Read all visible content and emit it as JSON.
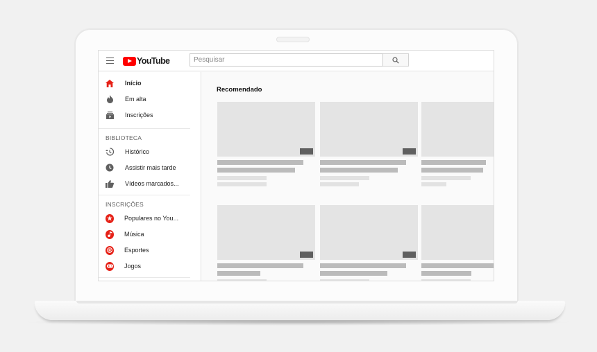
{
  "header": {
    "logo_text": "YouTube",
    "search_placeholder": "Pesquisar"
  },
  "sidebar": {
    "main_items": [
      {
        "label": "Início",
        "icon": "home-icon",
        "active": true
      },
      {
        "label": "Em alta",
        "icon": "flame-icon"
      },
      {
        "label": "Inscrições",
        "icon": "subscriptions-icon"
      }
    ],
    "library_title": "BIBLIOTECA",
    "library_items": [
      {
        "label": "Histórico",
        "icon": "history-icon"
      },
      {
        "label": "Assistir mais tarde",
        "icon": "clock-icon"
      },
      {
        "label": "Vídeos marcados...",
        "icon": "thumbs-up-icon"
      }
    ],
    "subscriptions_title": "INSCRIÇÕES",
    "subscription_items": [
      {
        "label": "Populares no You...",
        "icon": "star-icon"
      },
      {
        "label": "Música",
        "icon": "music-note-icon"
      },
      {
        "label": "Esportes",
        "icon": "sports-ball-icon"
      },
      {
        "label": "Jogos",
        "icon": "gamepad-icon"
      }
    ]
  },
  "main": {
    "section_title": "Recomendado"
  },
  "colors": {
    "brand_red": "#ff0000",
    "accent_red": "#e62117",
    "placeholder_gray": "#e4e4e4"
  }
}
